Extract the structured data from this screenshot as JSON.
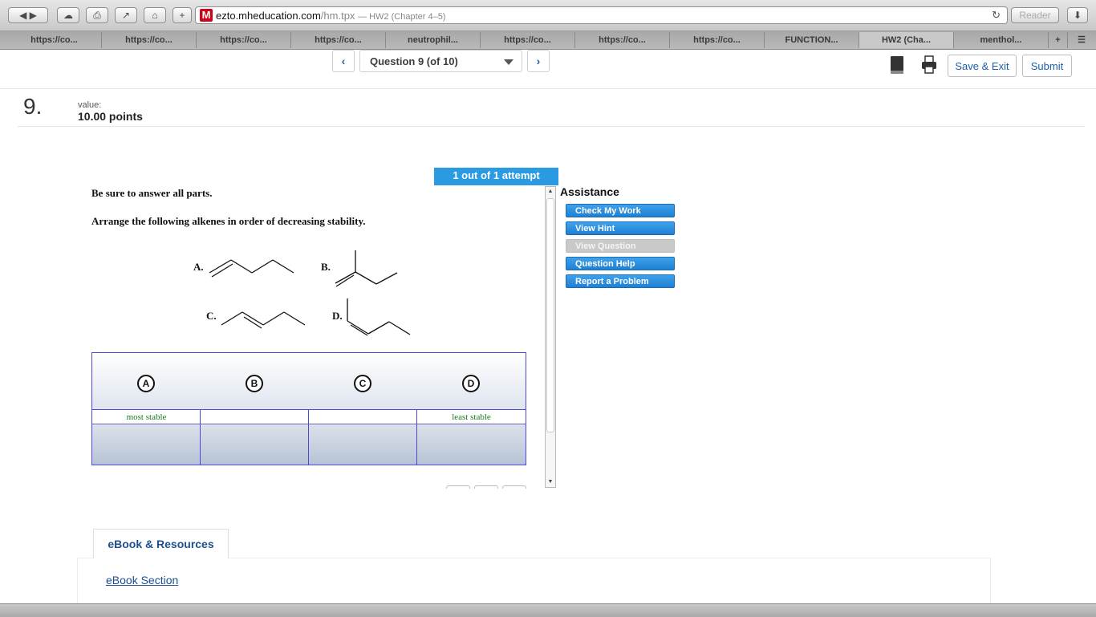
{
  "browser": {
    "url_host": "ezto.mheducation.com",
    "url_path": "/hm.tpx",
    "page_title": "— HW2 (Chapter 4–5)",
    "reader_label": "Reader",
    "tabs": [
      "https://co...",
      "https://co...",
      "https://co...",
      "https://co...",
      "neutrophil...",
      "https://co...",
      "https://co...",
      "https://co...",
      "FUNCTION...",
      "HW2 (Cha...",
      "menthol..."
    ]
  },
  "nav": {
    "question_select": "Question 9 (of 10)",
    "save_exit": "Save & Exit",
    "submit": "Submit"
  },
  "question": {
    "number": "9.",
    "value_label": "value:",
    "points": "10.00 points",
    "attempt": "1 out of 1 attempt",
    "instruction1": "Be sure to answer all parts.",
    "instruction2": "Arrange the following alkenes in order of decreasing stability.",
    "molecule_labels": [
      "A.",
      "B.",
      "C.",
      "D."
    ],
    "choices": [
      "A",
      "B",
      "C",
      "D"
    ],
    "slot_labels": [
      "most stable",
      "",
      "",
      "least stable"
    ]
  },
  "assistance": {
    "title": "Assistance",
    "buttons": [
      {
        "label": "Check My Work",
        "enabled": true
      },
      {
        "label": "View Hint",
        "enabled": true
      },
      {
        "label": "View Question",
        "enabled": false
      },
      {
        "label": "Question Help",
        "enabled": true
      },
      {
        "label": "Report a Problem",
        "enabled": true
      }
    ]
  },
  "ebook": {
    "tab_label": "eBook & Resources",
    "link": "eBook Section"
  }
}
